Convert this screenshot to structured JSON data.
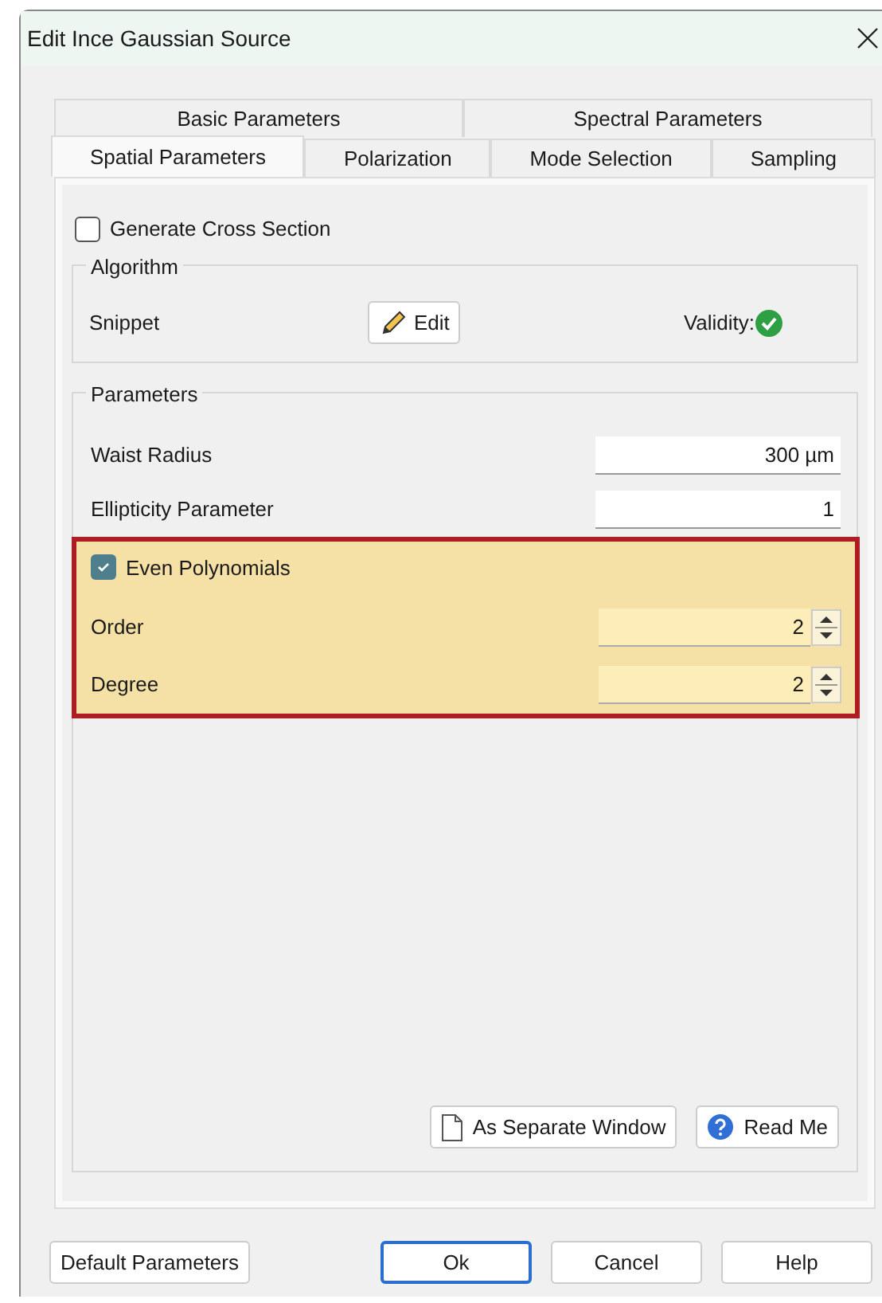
{
  "window": {
    "title": "Edit Ince Gaussian Source"
  },
  "tab_rows": [
    [
      {
        "label": "Basic Parameters",
        "selected": false
      },
      {
        "label": "Spectral Parameters",
        "selected": false
      }
    ],
    [
      {
        "label": "Spatial Parameters",
        "selected": true
      },
      {
        "label": "Polarization",
        "selected": false
      },
      {
        "label": "Mode Selection",
        "selected": false
      },
      {
        "label": "Sampling",
        "selected": false
      }
    ]
  ],
  "generate_cross_section": {
    "label": "Generate Cross Section",
    "checked": false
  },
  "algorithm": {
    "title": "Algorithm",
    "snippet_label": "Snippet",
    "edit_button": "Edit",
    "validity_label": "Validity:",
    "valid": true
  },
  "parameters": {
    "title": "Parameters",
    "fields": [
      {
        "label": "Waist Radius",
        "value": "300 µm"
      },
      {
        "label": "Ellipticity Parameter",
        "value": "1"
      }
    ],
    "highlight": {
      "checkbox": {
        "label": "Even Polynomials",
        "checked": true
      },
      "spinners": [
        {
          "label": "Order",
          "value": "2"
        },
        {
          "label": "Degree",
          "value": "2"
        }
      ]
    }
  },
  "panel_buttons": [
    {
      "kind": "window",
      "label": "As Separate Window"
    },
    {
      "kind": "help",
      "label": "Read Me"
    }
  ],
  "footer_buttons": [
    {
      "label": "Default Parameters",
      "default": false
    },
    {
      "label": "Ok",
      "default": true
    },
    {
      "label": "Cancel",
      "default": false
    },
    {
      "label": "Help",
      "default": false
    }
  ]
}
